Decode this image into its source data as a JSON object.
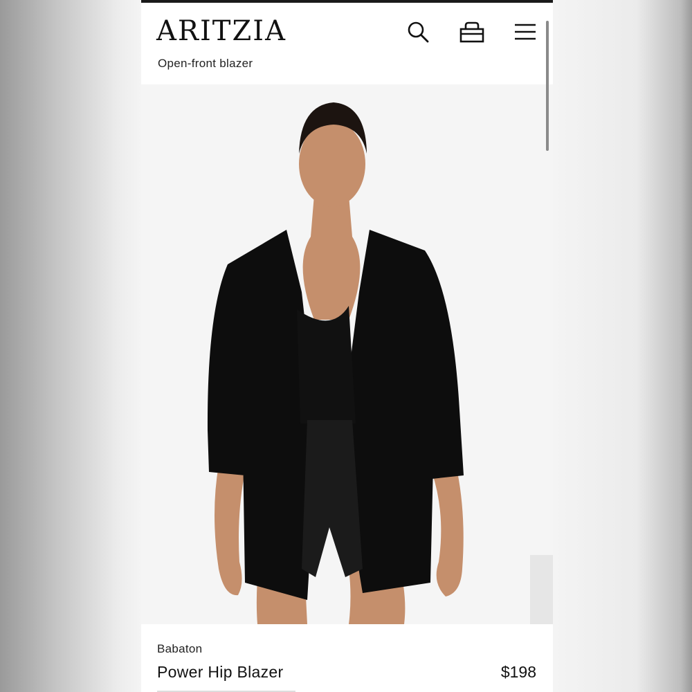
{
  "header": {
    "logo": "ARITZIA",
    "subtitle": "Open-front blazer"
  },
  "icons": {
    "search": "search-icon",
    "bag": "shopping-bag-icon",
    "menu": "hamburger-menu-icon"
  },
  "product": {
    "image": "model-wearing-black-open-front-blazer",
    "brand": "Babaton",
    "name": "Power Hip Blazer",
    "price": "$198"
  },
  "colors": {
    "text": "#111111",
    "background": "#ffffff",
    "image_background": "#f5f5f5",
    "blazer": "#0d0d0d"
  }
}
